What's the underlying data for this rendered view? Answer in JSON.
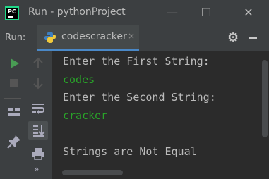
{
  "window": {
    "title": "Run - pythonProject",
    "app_icon_text": "PC",
    "minimize": "—",
    "maximize": "☐",
    "close": "✕"
  },
  "toolbar": {
    "run_label": "Run:",
    "tab_label": "codescracker",
    "tab_close": "×"
  },
  "console": {
    "lines": [
      {
        "text": "Enter the First String:",
        "kind": "output"
      },
      {
        "text": "codes",
        "kind": "input"
      },
      {
        "text": "Enter the Second String:",
        "kind": "output"
      },
      {
        "text": "cracker",
        "kind": "input"
      },
      {
        "text": "",
        "kind": "output"
      },
      {
        "text": "Strings are Not Equal",
        "kind": "output"
      }
    ]
  },
  "gutter": {
    "icons": [
      "run-icon",
      "stop-icon",
      "up-arrow-icon",
      "down-arrow-icon",
      "soft-wrap-icon",
      "layout-icon",
      "scroll-to-end-icon",
      "pin-icon",
      "print-icon",
      "more-icon"
    ],
    "more_label": "»"
  },
  "colors": {
    "background": "#2b2b2b",
    "chrome": "#3c3f41",
    "output_text": "#bbbbbb",
    "input_text": "#29a329",
    "run_green": "#499c54",
    "tab_accent": "#4a88c7"
  }
}
